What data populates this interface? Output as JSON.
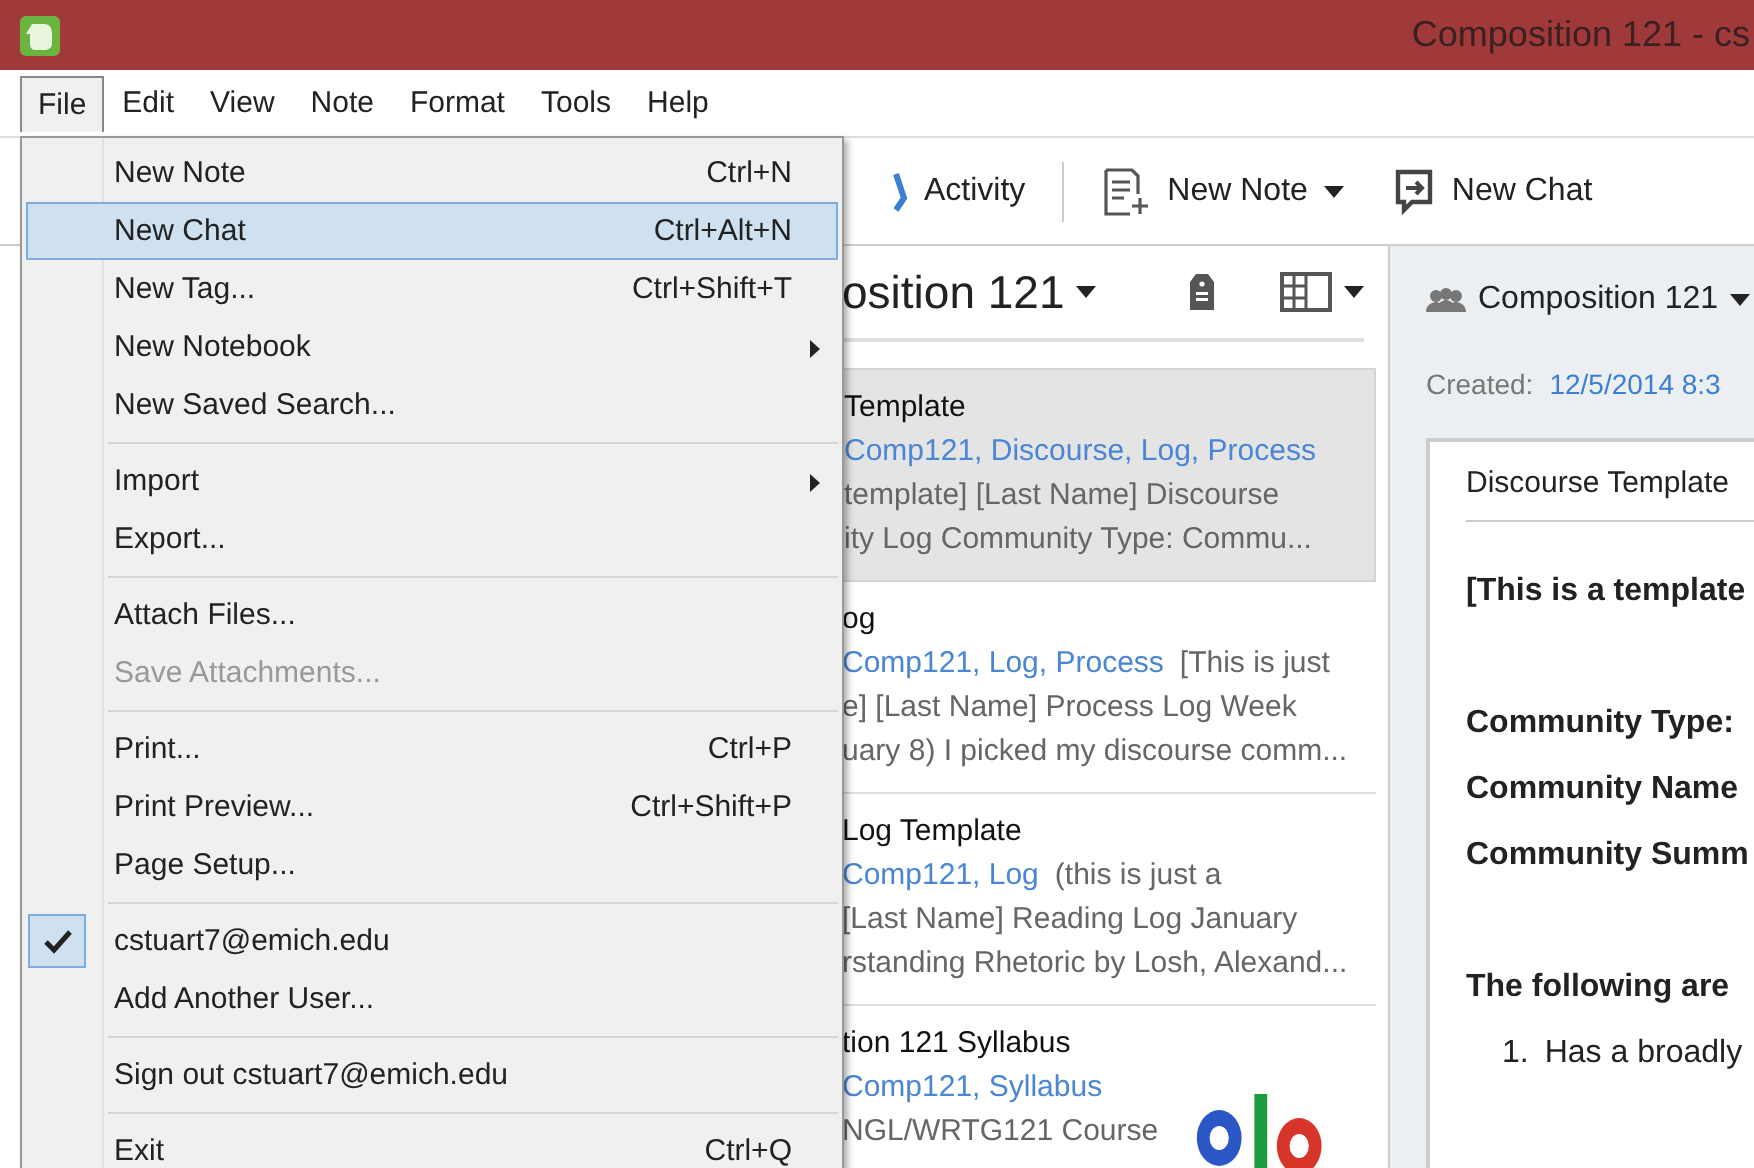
{
  "window": {
    "title": "Composition 121 - cs"
  },
  "menubar": [
    {
      "label": "File",
      "selected": true
    },
    {
      "label": "Edit",
      "selected": false
    },
    {
      "label": "View",
      "selected": false
    },
    {
      "label": "Note",
      "selected": false
    },
    {
      "label": "Format",
      "selected": false
    },
    {
      "label": "Tools",
      "selected": false
    },
    {
      "label": "Help",
      "selected": false
    }
  ],
  "toolbar": [
    {
      "kind": "activity",
      "label": "Activity"
    },
    {
      "kind": "new-note",
      "label": "New Note"
    },
    {
      "kind": "new-chat",
      "label": "New Chat"
    }
  ],
  "file_menu": [
    {
      "kind": "item",
      "label": "New Note",
      "shortcut": "Ctrl+N",
      "selected": false,
      "disabled": false,
      "checked": false,
      "submenu": false
    },
    {
      "kind": "item",
      "label": "New Chat",
      "shortcut": "Ctrl+Alt+N",
      "selected": true,
      "disabled": false,
      "checked": false,
      "submenu": false
    },
    {
      "kind": "item",
      "label": "New Tag...",
      "shortcut": "Ctrl+Shift+T",
      "selected": false,
      "disabled": false,
      "checked": false,
      "submenu": false
    },
    {
      "kind": "item",
      "label": "New Notebook",
      "selected": false,
      "disabled": false,
      "checked": false,
      "submenu": true
    },
    {
      "kind": "item",
      "label": "New Saved Search...",
      "selected": false,
      "disabled": false,
      "checked": false,
      "submenu": false
    },
    {
      "kind": "separator"
    },
    {
      "kind": "item",
      "label": "Import",
      "selected": false,
      "disabled": false,
      "checked": false,
      "submenu": true
    },
    {
      "kind": "item",
      "label": "Export...",
      "selected": false,
      "disabled": false,
      "checked": false,
      "submenu": false
    },
    {
      "kind": "separator"
    },
    {
      "kind": "item",
      "label": "Attach Files...",
      "selected": false,
      "disabled": false,
      "checked": false,
      "submenu": false
    },
    {
      "kind": "item",
      "label": "Save Attachments...",
      "selected": false,
      "disabled": true,
      "checked": false,
      "submenu": false
    },
    {
      "kind": "separator"
    },
    {
      "kind": "item",
      "label": "Print...",
      "shortcut": "Ctrl+P",
      "selected": false,
      "disabled": false,
      "checked": false,
      "submenu": false
    },
    {
      "kind": "item",
      "label": "Print Preview...",
      "shortcut": "Ctrl+Shift+P",
      "selected": false,
      "disabled": false,
      "checked": false,
      "submenu": false
    },
    {
      "kind": "item",
      "label": "Page Setup...",
      "selected": false,
      "disabled": false,
      "checked": false,
      "submenu": false
    },
    {
      "kind": "separator"
    },
    {
      "kind": "item",
      "label": "cstuart7@emich.edu",
      "selected": false,
      "disabled": false,
      "checked": true,
      "submenu": false
    },
    {
      "kind": "item",
      "label": "Add Another User...",
      "selected": false,
      "disabled": false,
      "checked": false,
      "submenu": false
    },
    {
      "kind": "separator"
    },
    {
      "kind": "item",
      "label": "Sign out cstuart7@emich.edu",
      "selected": false,
      "disabled": false,
      "checked": false,
      "submenu": false
    },
    {
      "kind": "separator"
    },
    {
      "kind": "item",
      "label": "Exit",
      "shortcut": "Ctrl+Q",
      "selected": false,
      "disabled": false,
      "checked": false,
      "submenu": false
    }
  ],
  "note_list": {
    "notebook": "osition 121",
    "notes": [
      {
        "title": "Template",
        "tags": "Comp121, Discourse, Log, Process",
        "lines": [
          "template] [Last Name] Discourse",
          "ity Log Community Type: Commu..."
        ],
        "selected": true
      },
      {
        "title": "og",
        "tags": "Comp121, Log, Process",
        "tag_line_text": "[This is just",
        "lines": [
          "e] [Last Name] Process Log Week",
          "uary 8) I picked my discourse comm..."
        ],
        "selected": false
      },
      {
        "title": "Log Template",
        "tags": "Comp121, Log",
        "tag_line_text": "(this is just a",
        "lines": [
          "[Last Name] Reading Log January",
          "rstanding Rhetoric by Losh, Alexand..."
        ],
        "selected": false
      },
      {
        "title": "tion 121 Syllabus",
        "tags": "Comp121, Syllabus",
        "lines": [
          "NGL/WRTG121 Course"
        ],
        "thumbnail": {
          "kind": "picture"
        },
        "selected": false
      }
    ]
  },
  "editor": {
    "notebook": "Composition 121",
    "created_label": "Created:",
    "created": "12/5/2014 8:3",
    "doc_title": "Discourse Template",
    "body": [
      {
        "kind": "bold",
        "text": "[This is a template"
      },
      {
        "kind": "gap"
      },
      {
        "kind": "bold",
        "text": "Community Type:"
      },
      {
        "kind": "bold",
        "text": "Community Name"
      },
      {
        "kind": "bold",
        "text": "Community Summ"
      },
      {
        "kind": "gap"
      },
      {
        "kind": "bold",
        "text": "The following are"
      },
      {
        "kind": "numbered",
        "number": "1.",
        "text": "Has a broadly"
      }
    ]
  }
}
